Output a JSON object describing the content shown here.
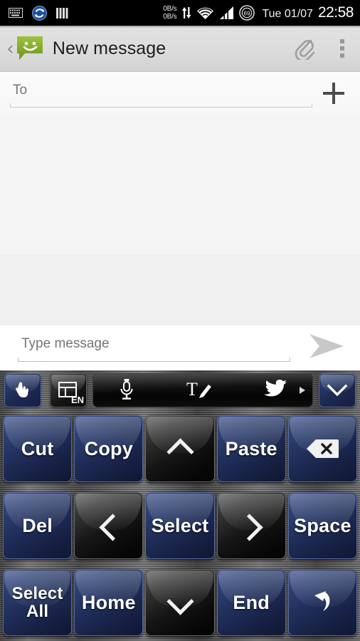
{
  "statusbar": {
    "icons_left": [
      "keyboard-icon",
      "sync-icon",
      "signal-bars-icon"
    ],
    "network_speed_up": "0B/s",
    "network_speed_down": "0B/s",
    "icons_right": [
      "data-transfer-icon",
      "wifi-icon",
      "cellular-signal-icon"
    ],
    "battery_percent": "69",
    "date": "Tue 01/07",
    "time": "22:58"
  },
  "actionbar": {
    "back_glyph": "‹",
    "app_icon": "messaging-bubble-icon",
    "title": "New message",
    "attach_icon": "paperclip-icon",
    "overflow_icon": "overflow-menu-icon"
  },
  "recipient": {
    "placeholder": "To",
    "value": "",
    "add_contact_icon": "plus-icon"
  },
  "compose": {
    "placeholder": "Type message",
    "value": "",
    "send_icon": "send-arrow-icon"
  },
  "keyboard": {
    "toolbar": {
      "left_keys": [
        {
          "name": "pointer-hand-key",
          "icon": "hand-pointer-icon",
          "style": "blue"
        },
        {
          "name": "language-layout-key",
          "icon": "layout-grid-icon",
          "label": "EN",
          "style": "black"
        }
      ],
      "strip_items": [
        {
          "name": "voice-input",
          "icon": "microphone-icon"
        },
        {
          "name": "text-edit",
          "icon": "text-pencil-icon"
        },
        {
          "name": "twitter-share",
          "icon": "twitter-bird-icon"
        }
      ],
      "strip_more_icon": "strip-right-arrow-icon",
      "right_key": {
        "name": "hide-keyboard-key",
        "icon": "chevron-down-icon",
        "style": "blue"
      }
    },
    "rows": [
      [
        {
          "label": "Cut",
          "style": "blue",
          "icon": null,
          "name": "key-cut"
        },
        {
          "label": "Copy",
          "style": "blue",
          "icon": null,
          "name": "key-copy"
        },
        {
          "label": "",
          "style": "black",
          "icon": "chevron-up-icon",
          "name": "key-arrow-up"
        },
        {
          "label": "Paste",
          "style": "blue",
          "icon": null,
          "name": "key-paste"
        },
        {
          "label": "",
          "style": "blue",
          "icon": "backspace-icon",
          "name": "key-backspace"
        }
      ],
      [
        {
          "label": "Del",
          "style": "blue",
          "icon": null,
          "name": "key-del"
        },
        {
          "label": "",
          "style": "black",
          "icon": "chevron-left-icon",
          "name": "key-arrow-left"
        },
        {
          "label": "Select",
          "style": "blue",
          "icon": null,
          "name": "key-select"
        },
        {
          "label": "",
          "style": "black",
          "icon": "chevron-right-icon",
          "name": "key-arrow-right"
        },
        {
          "label": "Space",
          "style": "blue",
          "icon": null,
          "name": "key-space"
        }
      ],
      [
        {
          "label": "Select\nAll",
          "style": "blue",
          "icon": null,
          "name": "key-select-all"
        },
        {
          "label": "Home",
          "style": "blue",
          "icon": null,
          "name": "key-home"
        },
        {
          "label": "",
          "style": "black",
          "icon": "chevron-down-icon",
          "name": "key-arrow-down"
        },
        {
          "label": "End",
          "style": "blue",
          "icon": null,
          "name": "key-end"
        },
        {
          "label": "",
          "style": "blue",
          "icon": "undo-icon",
          "name": "key-undo"
        }
      ]
    ]
  },
  "colors": {
    "statusbar_bg": "#000000",
    "actionbar_bg": "#dcdcdc",
    "app_icon_green": "#8ab234",
    "key_blue": "#1e2c57",
    "key_black": "#161616",
    "body_bg": "#f5f5f5"
  }
}
